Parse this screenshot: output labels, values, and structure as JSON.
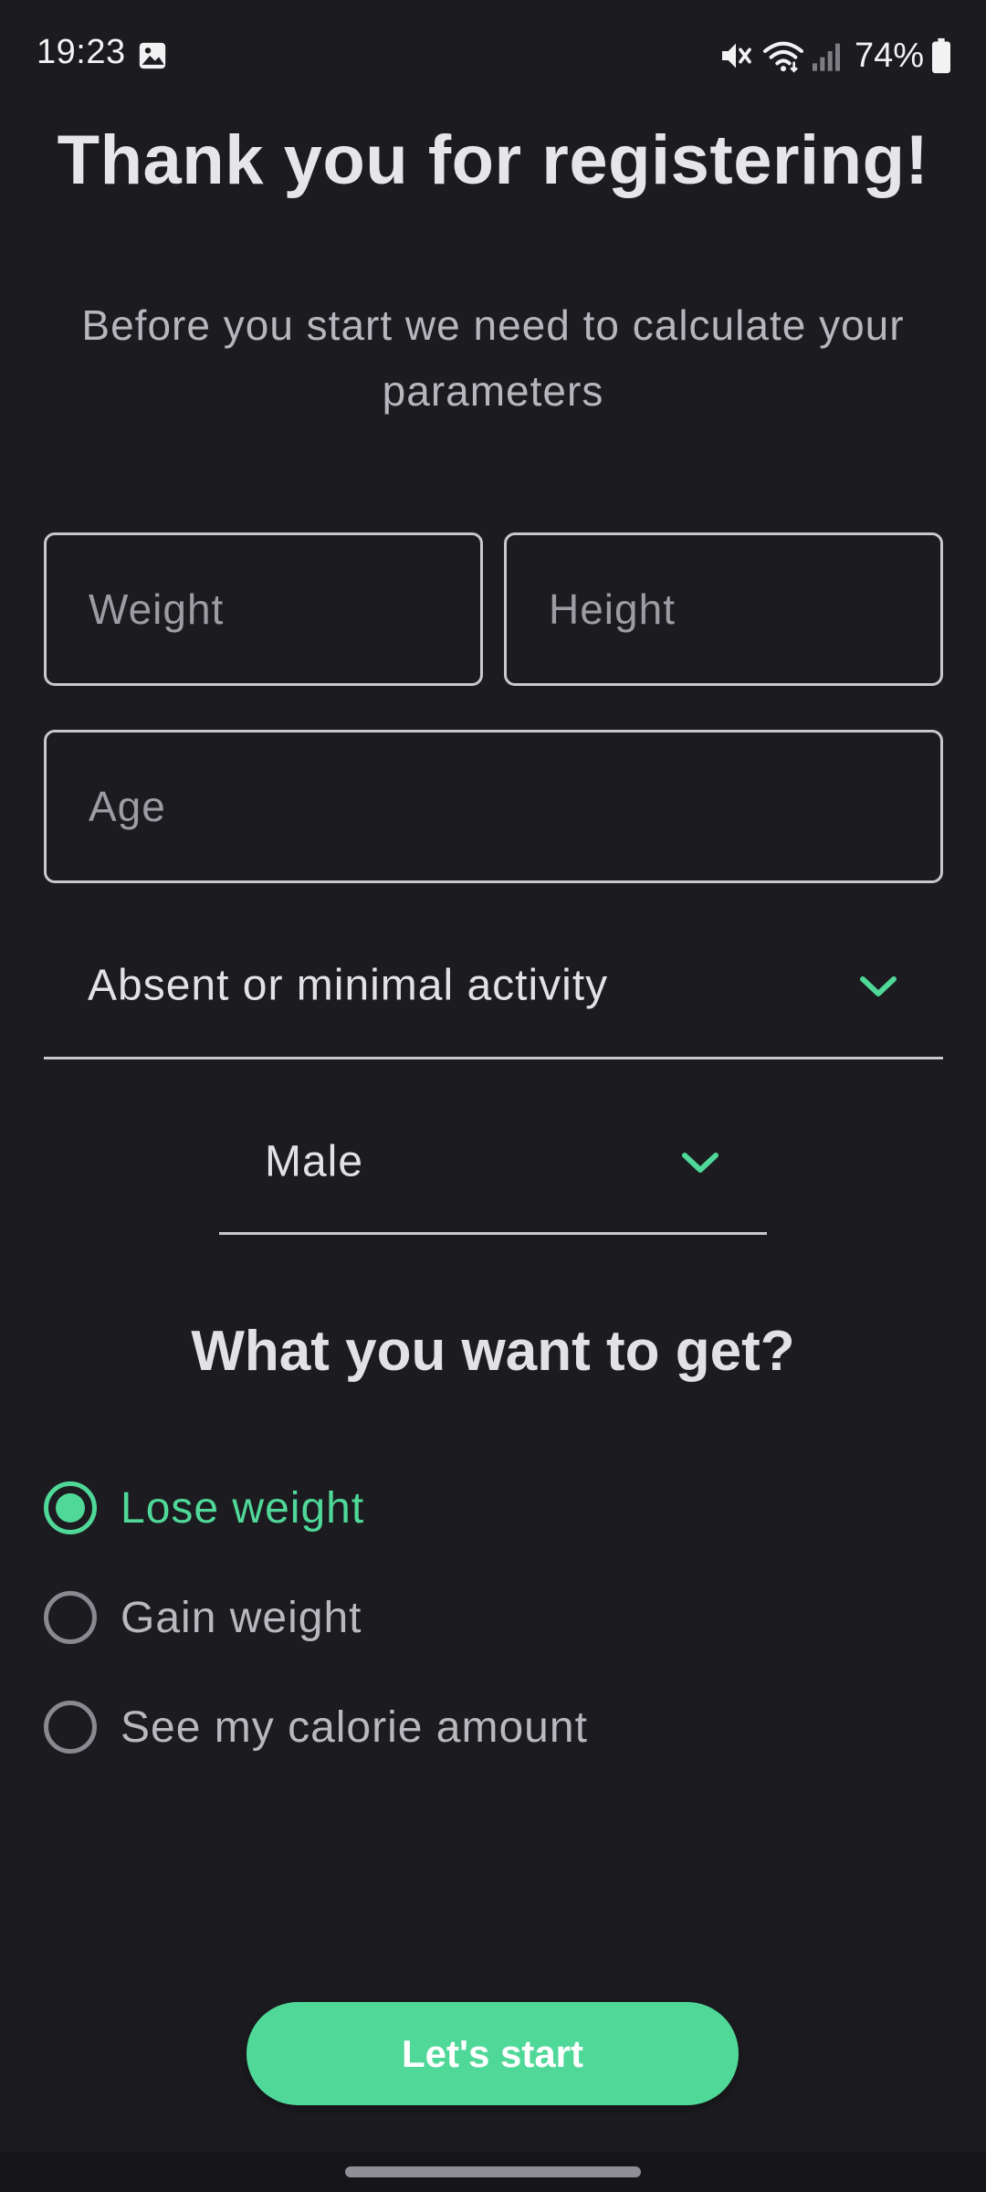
{
  "status_bar": {
    "time": "19:23",
    "battery_percent": "74%",
    "icons": [
      "gallery-icon",
      "mute-icon",
      "wifi-icon",
      "signal-icon",
      "battery-icon"
    ]
  },
  "header": {
    "title": "Thank you for registering!",
    "subtitle": "Before you start we need to calculate your parameters"
  },
  "form": {
    "weight_placeholder": "Weight",
    "height_placeholder": "Height",
    "age_placeholder": "Age",
    "activity_selected": "Absent or minimal activity",
    "gender_selected": "Male"
  },
  "goal": {
    "heading": "What you want to get?",
    "options": [
      {
        "label": "Lose weight",
        "selected": true
      },
      {
        "label": "Gain weight",
        "selected": false
      },
      {
        "label": "See my calorie amount",
        "selected": false
      }
    ]
  },
  "actions": {
    "start_label": "Let's start"
  },
  "colors": {
    "background": "#1c1b20",
    "accent": "#4fd898",
    "text_primary": "#e2e2e6",
    "text_secondary": "#b7b6bd",
    "outline": "#c9c8ce"
  }
}
